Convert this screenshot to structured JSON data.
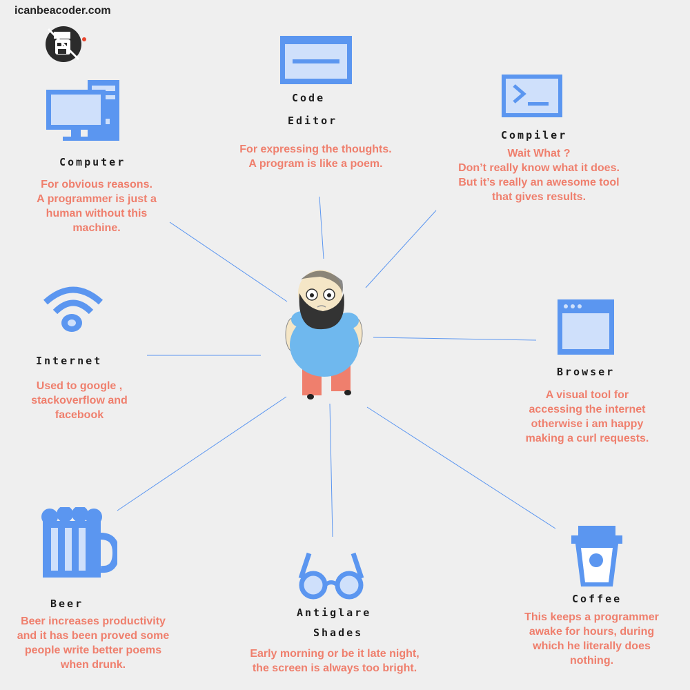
{
  "site_title": "icanbeacoder.com",
  "accent_color": "#5b96f0",
  "text_color": "#ef7f6d",
  "items": [
    {
      "key": "computer",
      "icon": "computer-icon",
      "title": [
        "Computer"
      ],
      "desc": [
        "For obvious reasons.",
        "A programmer is just a",
        "human without this",
        "machine."
      ]
    },
    {
      "key": "code-editor",
      "icon": "code-editor-icon",
      "title": [
        "Code",
        "Editor"
      ],
      "desc": [
        "For expressing the thoughts.",
        "A program is like a poem."
      ]
    },
    {
      "key": "compiler",
      "icon": "terminal-icon",
      "title": [
        "Compiler"
      ],
      "desc": [
        "Wait What ?",
        "Don’t really know what it does.",
        "But it’s really an awesome tool",
        "that gives results."
      ]
    },
    {
      "key": "internet",
      "icon": "wifi-icon",
      "title": [
        "Internet"
      ],
      "desc": [
        "Used to google ,",
        "stackoverflow and",
        "facebook"
      ]
    },
    {
      "key": "browser",
      "icon": "browser-window-icon",
      "title": [
        "Browser"
      ],
      "desc": [
        "A visual tool for",
        "accessing the internet",
        "otherwise i am happy",
        "making a curl requests."
      ]
    },
    {
      "key": "beer",
      "icon": "beer-mug-icon",
      "title": [
        "Beer"
      ],
      "desc": [
        "Beer increases productivity",
        "and it has  been proved some",
        "people write better poems",
        "when drunk."
      ]
    },
    {
      "key": "antiglare-shades",
      "icon": "glasses-icon",
      "title": [
        "Antiglare",
        "Shades"
      ],
      "desc": [
        "Early morning or be it late night,",
        "the screen is always too bright."
      ]
    },
    {
      "key": "coffee",
      "icon": "coffee-cup-icon",
      "title": [
        "Coffee"
      ],
      "desc": [
        "This keeps a programmer",
        "awake for hours, during",
        "which he literally does",
        "nothing."
      ]
    }
  ]
}
